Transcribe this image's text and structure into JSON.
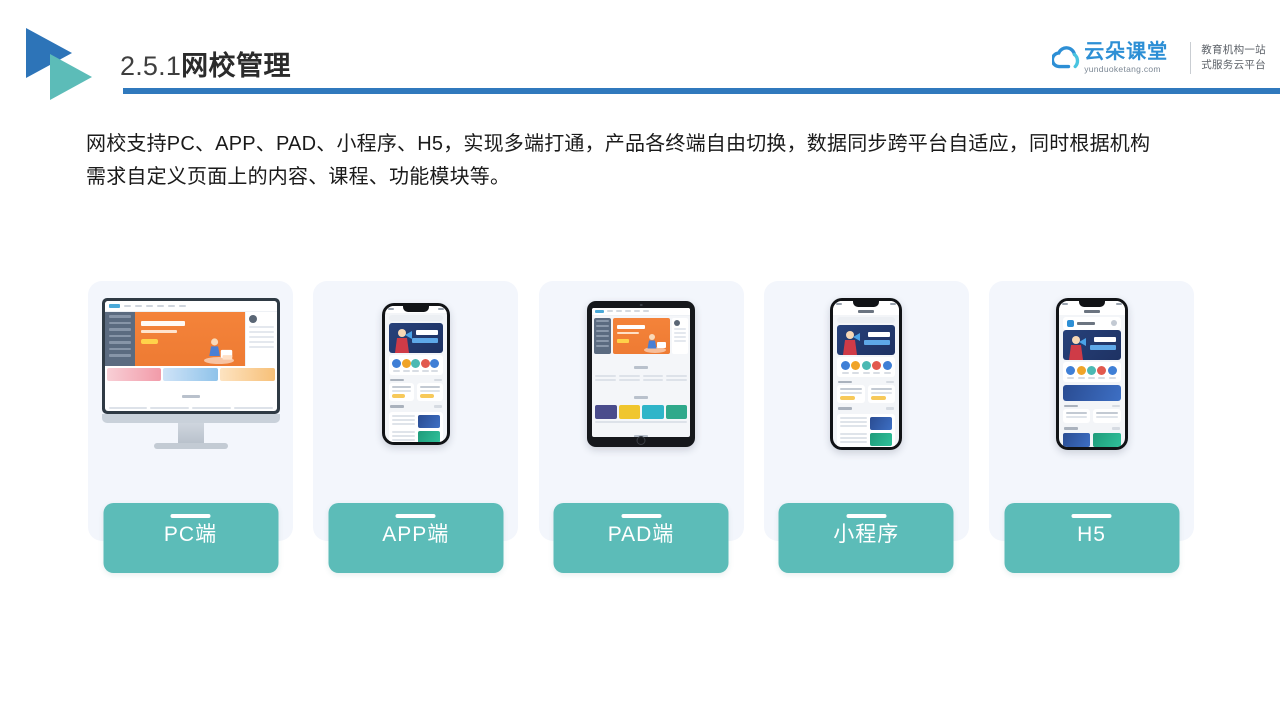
{
  "header": {
    "title_number": "2.5.1",
    "title_text": "网校管理",
    "logo_icon": "double-triangle-icon",
    "rule_color": "#3079bd"
  },
  "brand": {
    "cloud_icon": "cloud-icon",
    "name": "云朵课堂",
    "url": "yunduoketang.com",
    "tagline_line1": "教育机构一站",
    "tagline_line2": "式服务云平台",
    "accent_color": "#2d8fd5"
  },
  "body": {
    "paragraph_line1": "网校支持PC、APP、PAD、小程序、H5，实现多端打通，产品各终端自由切换，数据同步跨平台自适应，同时根据机构",
    "paragraph_line2": "需求自定义页面上的内容、课程、功能模块等。"
  },
  "cards": [
    {
      "label": "PC端",
      "device": "desktop-monitor-mockup",
      "name": "card-pc"
    },
    {
      "label": "APP端",
      "device": "smartphone-mockup",
      "name": "card-app"
    },
    {
      "label": "PAD端",
      "device": "tablet-mockup",
      "name": "card-pad"
    },
    {
      "label": "小程序",
      "device": "smartphone-mockup",
      "name": "card-miniprogram"
    },
    {
      "label": "H5",
      "device": "smartphone-mockup",
      "name": "card-h5"
    }
  ],
  "theme": {
    "label_bg": "#5cbcb8",
    "card_bg": "#f3f6fc",
    "page_bg": "#ffffff",
    "title_blue": "#2d74b8",
    "title_teal": "#5cbcb8"
  }
}
